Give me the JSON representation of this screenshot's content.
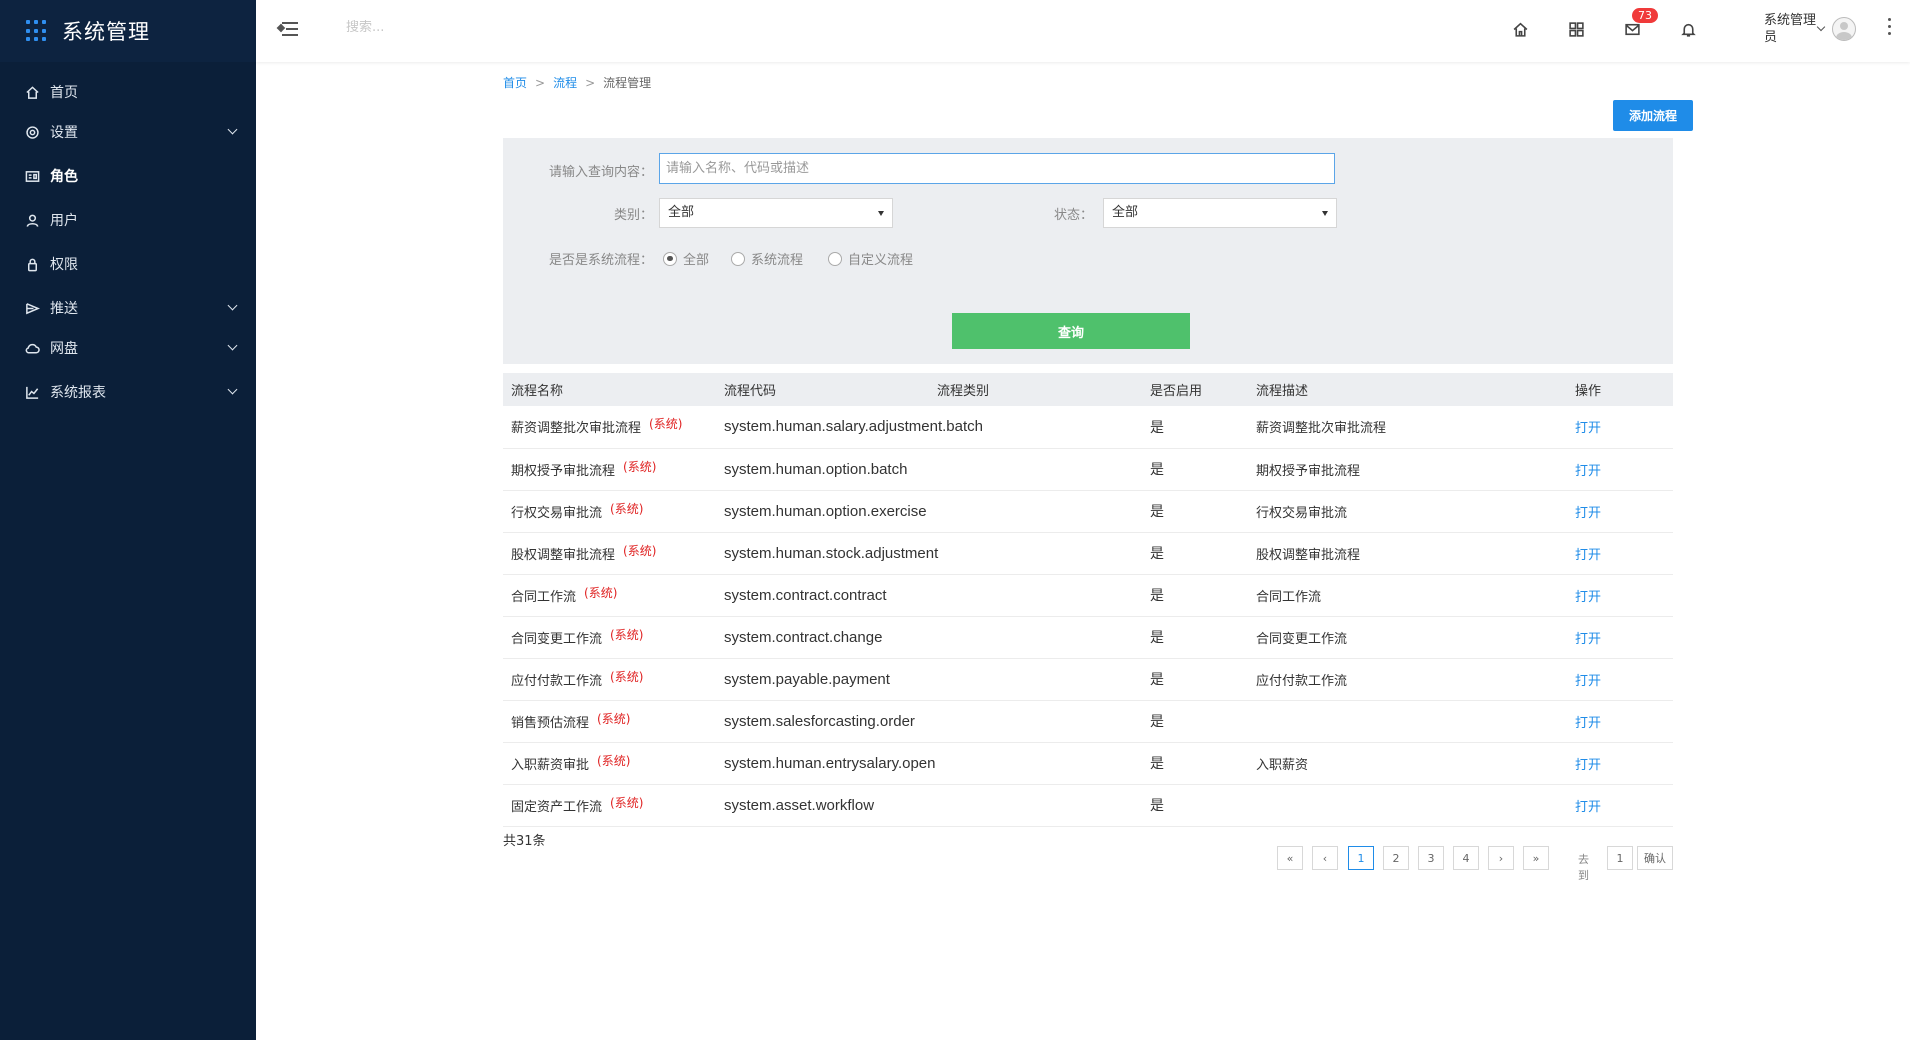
{
  "brand": {
    "title": "系统管理",
    "grid_color": "#2f8ff0"
  },
  "sidebar": {
    "items": [
      {
        "label": "首页",
        "icon": "home-icon",
        "expandable": false,
        "active": false
      },
      {
        "label": "设置",
        "icon": "settings-icon",
        "expandable": true,
        "active": false
      },
      {
        "label": "角色",
        "icon": "id-card-icon",
        "expandable": false,
        "active": true
      },
      {
        "label": "用户",
        "icon": "user-icon",
        "expandable": false,
        "active": false
      },
      {
        "label": "权限",
        "icon": "lock-icon",
        "expandable": false,
        "active": false
      },
      {
        "label": "推送",
        "icon": "send-icon",
        "expandable": true,
        "active": false
      },
      {
        "label": "网盘",
        "icon": "cloud-icon",
        "expandable": true,
        "active": false
      },
      {
        "label": "系统报表",
        "icon": "chart-line-icon",
        "expandable": true,
        "active": false
      }
    ]
  },
  "header": {
    "search_placeholder": "搜索...",
    "mail_badge": "73",
    "username": "系统管理员"
  },
  "breadcrumb": {
    "home": "首页",
    "level2": "流程",
    "current": "流程管理",
    "sep": ">"
  },
  "add_button": "添加流程",
  "filter": {
    "query_label": "请输入查询内容：",
    "query_placeholder": "请输入名称、代码或描述",
    "category_label": "类别：",
    "category_value": "全部",
    "status_label": "状态：",
    "status_value": "全部",
    "system_label": "是否是系统流程：",
    "radio_all": "全部",
    "radio_system": "系统流程",
    "radio_custom": "自定义流程",
    "query_button": "查询"
  },
  "table": {
    "headers": [
      "流程名称",
      "流程代码",
      "流程类别",
      "是否启用",
      "流程描述",
      "操作"
    ],
    "rows": [
      {
        "name": "薪资调整批次审批流程",
        "tag": "(系统)",
        "code": "system.human.salary.adjustment.batch",
        "category": "",
        "enabled": "是",
        "desc": "薪资调整批次审批流程",
        "op": "打开"
      },
      {
        "name": "期权授予审批流程",
        "tag": "(系统)",
        "code": "system.human.option.batch",
        "category": "",
        "enabled": "是",
        "desc": "期权授予审批流程",
        "op": "打开"
      },
      {
        "name": "行权交易审批流",
        "tag": "(系统)",
        "code": "system.human.option.exercise",
        "category": "",
        "enabled": "是",
        "desc": "行权交易审批流",
        "op": "打开"
      },
      {
        "name": "股权调整审批流程",
        "tag": "(系统)",
        "code": "system.human.stock.adjustment",
        "category": "",
        "enabled": "是",
        "desc": "股权调整审批流程",
        "op": "打开"
      },
      {
        "name": "合同工作流",
        "tag": "(系统)",
        "code": "system.contract.contract",
        "category": "",
        "enabled": "是",
        "desc": "合同工作流",
        "op": "打开"
      },
      {
        "name": "合同变更工作流",
        "tag": "(系统)",
        "code": "system.contract.change",
        "category": "",
        "enabled": "是",
        "desc": "合同变更工作流",
        "op": "打开"
      },
      {
        "name": "应付付款工作流",
        "tag": "(系统)",
        "code": "system.payable.payment",
        "category": "",
        "enabled": "是",
        "desc": "应付付款工作流",
        "op": "打开"
      },
      {
        "name": "销售预估流程",
        "tag": "(系统)",
        "code": "system.salesforcasting.order",
        "category": "",
        "enabled": "是",
        "desc": "",
        "op": "打开"
      },
      {
        "name": "入职薪资审批",
        "tag": "(系统)",
        "code": "system.human.entrysalary.open",
        "category": "",
        "enabled": "是",
        "desc": "入职薪资",
        "op": "打开"
      },
      {
        "name": "固定资产工作流",
        "tag": "(系统)",
        "code": "system.asset.workflow",
        "category": "",
        "enabled": "是",
        "desc": "",
        "op": "打开"
      }
    ]
  },
  "pagination": {
    "total": "共31条",
    "first": "«",
    "prev": "‹",
    "pages": [
      "1",
      "2",
      "3",
      "4"
    ],
    "current": "1",
    "next": "›",
    "last": "»",
    "goto_label": "去到",
    "goto_value": "1",
    "confirm": "确认"
  },
  "colors": {
    "sidebar_bg": "#0b1f39",
    "primary": "#1f8ce8",
    "success": "#4fc16c",
    "system_tag": "#e02323",
    "badge": "#f03a3a"
  }
}
